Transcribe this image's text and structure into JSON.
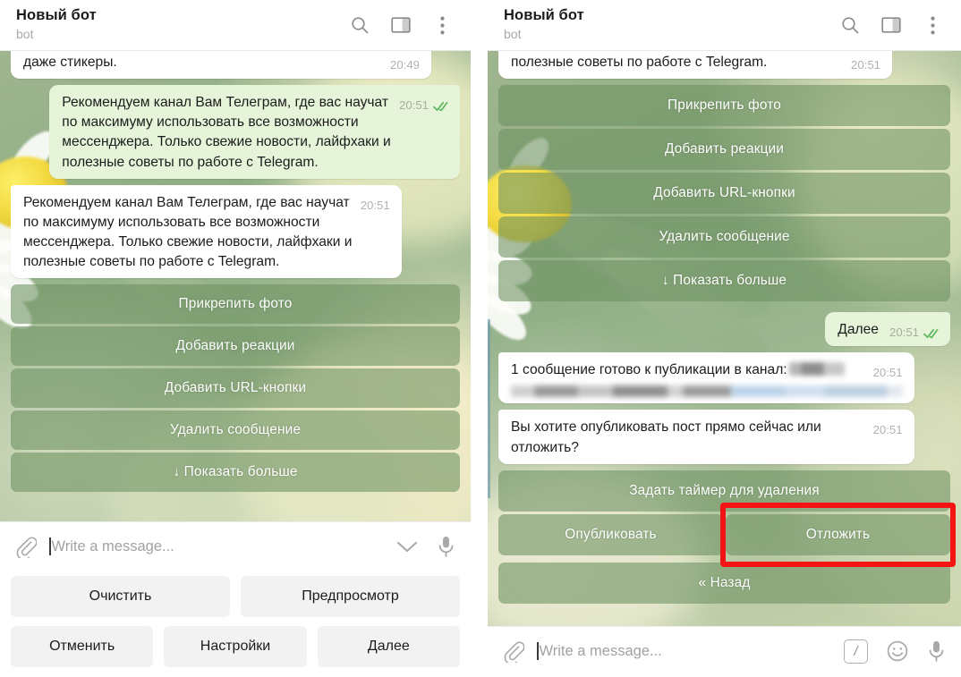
{
  "header": {
    "title": "Новый бот",
    "subtitle": "bot",
    "icons": [
      "search-icon",
      "sidebar-toggle-icon",
      "more-menu-icon"
    ]
  },
  "left_panel": {
    "messages": [
      {
        "id": "m-stickers",
        "side": "in",
        "text": "даже стикеры.",
        "time": "20:49",
        "clipped": true
      },
      {
        "id": "m-out-recommend",
        "side": "out",
        "text": "Рекомендуем канал Вам Телеграм, где вас научат\nпо максимуму использовать все возможности\nмессенджера. Только свежие новости, лайфхаки и\nполезные советы по работе с Telegram.",
        "time": "20:51",
        "ticks": true
      },
      {
        "id": "m-in-recommend",
        "side": "in",
        "text": "Рекомендуем канал Вам Телеграм, где вас научат\nпо максимуму использовать все возможности\nмессенджера. Только свежие новости, лайфхаки и\nполезные советы по работе с Telegram.",
        "time": "20:51",
        "ticks": false
      }
    ],
    "inline_keyboard": [
      "Прикрепить фото",
      "Добавить реакции",
      "Добавить URL-кнопки",
      "Удалить сообщение",
      "↓ Показать больше"
    ],
    "composer": {
      "placeholder": "Write a message...",
      "value": "",
      "icons": [
        "attach-icon",
        "chevron-down-icon",
        "microphone-icon"
      ]
    },
    "reply_keyboard": [
      [
        "Очистить",
        "Предпросмотр"
      ],
      [
        "Отменить",
        "Настройки",
        "Далее"
      ]
    ]
  },
  "right_panel": {
    "messages": [
      {
        "id": "r-clipped",
        "side": "in",
        "text": "полезные советы по работе с Telegram.",
        "time": "20:51",
        "clipped": true
      },
      {
        "id": "r-next",
        "side": "out",
        "text": "Далее",
        "time": "20:51",
        "ticks": true
      },
      {
        "id": "r-ready",
        "side": "in",
        "text": "1 сообщение готово к публикации в канал:",
        "time": "20:51",
        "redacted": true
      },
      {
        "id": "r-question",
        "side": "in",
        "text": "Вы хотите опубликовать пост прямо сейчас или\nотложить?",
        "time": "20:51"
      }
    ],
    "inline_keyboard_top": [
      "Прикрепить фото",
      "Добавить реакции",
      "Добавить URL-кнопки",
      "Удалить сообщение",
      "↓ Показать больше"
    ],
    "inline_keyboard_bottom": {
      "timer": "Задать таймер для удаления",
      "publish": "Опубликовать",
      "postpone": "Отложить",
      "back": "« Назад"
    },
    "composer": {
      "placeholder": "Write a message...",
      "value": "",
      "icons": [
        "attach-icon",
        "command-slash-icon",
        "emoji-icon",
        "microphone-icon"
      ],
      "command_glyph": "/"
    }
  },
  "annotation": {
    "highlight_target": "Отложить",
    "color": "#f51414"
  },
  "colors": {
    "outgoing_bubble": "#e6f4d9",
    "incoming_bubble": "#ffffff",
    "inline_button": "rgba(108,145,96,.58)",
    "reply_button": "#f2f2f2",
    "tick": "#5cb85c",
    "highlight": "#f51414"
  }
}
